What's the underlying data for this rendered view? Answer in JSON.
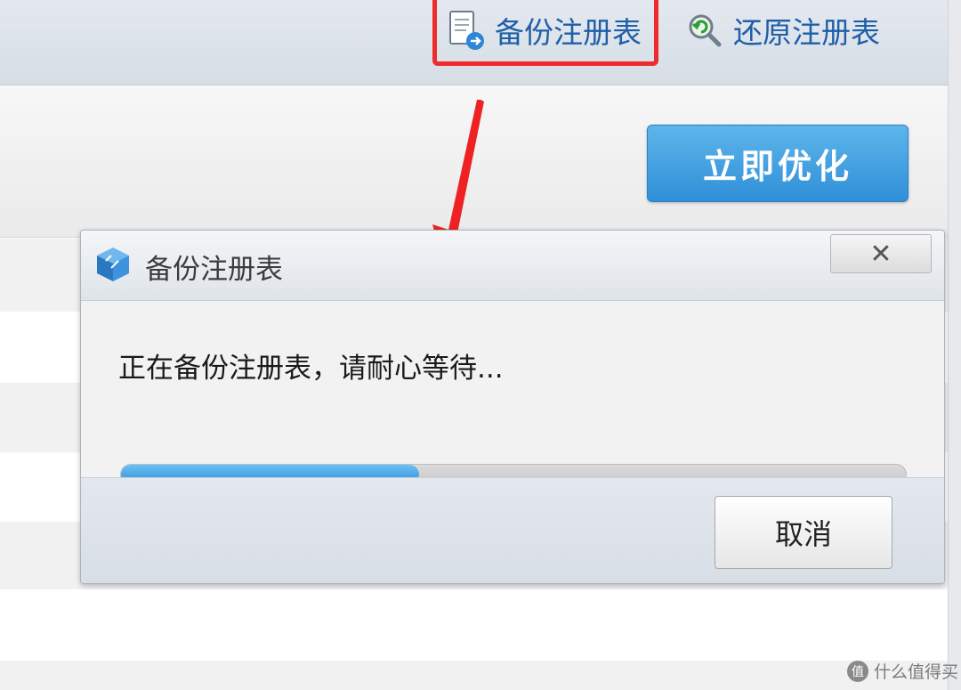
{
  "toolbar": {
    "backup_label": "备份注册表",
    "backup_icon": "document-export-icon",
    "restore_label": "还原注册表",
    "restore_icon": "restore-magnifier-icon"
  },
  "actions": {
    "optimize_label": "立即优化"
  },
  "dialog": {
    "title": "备份注册表",
    "close_label": "✕",
    "status_text": "正在备份注册表，请耐心等待...",
    "progress_percent": 38,
    "cancel_label": "取消"
  },
  "watermark": {
    "icon_glyph": "值",
    "text": "什么值得买"
  },
  "colors": {
    "accent": "#2f8fd8",
    "highlight": "#ef2b2b",
    "link": "#1f5fa8"
  }
}
